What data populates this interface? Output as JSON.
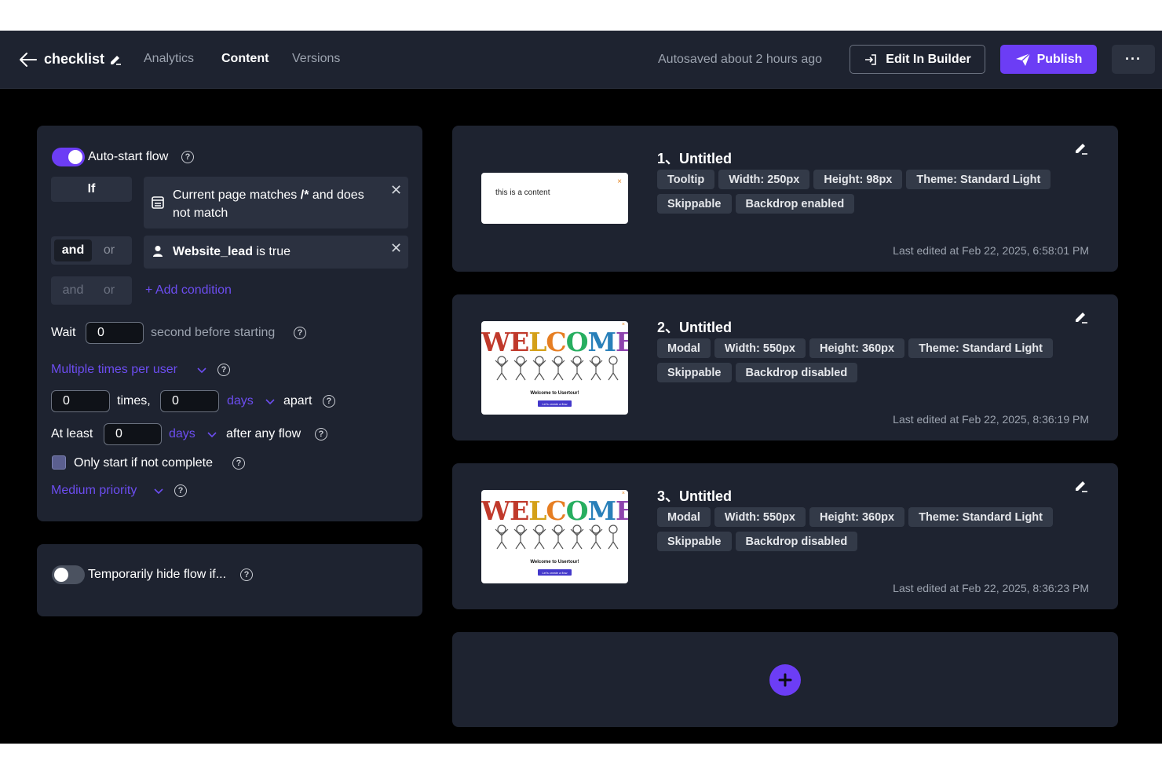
{
  "header": {
    "flow_name": "checklist",
    "tabs": [
      {
        "label": "Analytics"
      },
      {
        "label": "Content"
      },
      {
        "label": "Versions"
      }
    ],
    "autosave": "Autosaved about 2 hours ago",
    "edit_in_builder": "Edit In Builder",
    "publish": "Publish",
    "more": "···"
  },
  "autostart": {
    "toggle_label": "Auto-start flow",
    "if_label": "If",
    "condition_1": {
      "text_a": "Current page matches ",
      "text_b": "/*",
      "text_c": " and does",
      "text_d": "not match"
    },
    "and_label": "and",
    "or_label": "or",
    "condition_2": {
      "attr": "Website_lead",
      "rest": " is true"
    },
    "add_condition": "+ Add condition",
    "wait_label": "Wait",
    "wait_value": "0",
    "wait_suffix": "second before starting",
    "frequency": "Multiple times per user",
    "times_value": "0",
    "times_label": "times,",
    "days_value": "0",
    "days_unit": "days",
    "apart_label": "apart",
    "atleast_label": "At least",
    "atleast_value": "0",
    "atleast_unit": "days",
    "after_label": "after any flow",
    "only_start_label": "Only start if not complete",
    "priority": "Medium priority"
  },
  "hide": {
    "toggle_label": "Temporarily hide flow if..."
  },
  "steps": [
    {
      "title": "1、Untitled",
      "chips": [
        "Tooltip",
        "Width: 250px",
        "Height: 98px",
        "Theme: Standard Light",
        "Skippable",
        "Backdrop enabled"
      ],
      "edited": "Last edited at Feb 22, 2025, 6:58:01 PM",
      "preview_text": "this is a content",
      "preview_close": "×"
    },
    {
      "title": "2、Untitled",
      "chips": [
        "Modal",
        "Width: 550px",
        "Height: 360px",
        "Theme: Standard Light",
        "Skippable",
        "Backdrop disabled"
      ],
      "edited": "Last edited at Feb 22, 2025, 8:36:19 PM",
      "preview_subtitle": "Welcome to Usertour!",
      "preview_button": "Let's create a flow",
      "preview_close": "×"
    },
    {
      "title": "3、Untitled",
      "chips": [
        "Modal",
        "Width: 550px",
        "Height: 360px",
        "Theme: Standard Light",
        "Skippable",
        "Backdrop disabled"
      ],
      "edited": "Last edited at Feb 22, 2025, 8:36:23 PM",
      "preview_subtitle": "Welcome to Usertour!",
      "preview_button": "Let's create a flow",
      "preview_close": "×"
    }
  ],
  "welcome_letters": [
    {
      "ch": "W",
      "color": "#c0392b"
    },
    {
      "ch": "E",
      "color": "#c0392b"
    },
    {
      "ch": "L",
      "color": "#d4a017"
    },
    {
      "ch": "C",
      "color": "#e67e22"
    },
    {
      "ch": "O",
      "color": "#27ae60"
    },
    {
      "ch": "M",
      "color": "#2980b9"
    },
    {
      "ch": "E",
      "color": "#8e44ad"
    }
  ],
  "colors": {
    "accent": "#6c3df5",
    "panel": "#1e2330",
    "chip": "#333a48",
    "link": "#6c4df0"
  }
}
